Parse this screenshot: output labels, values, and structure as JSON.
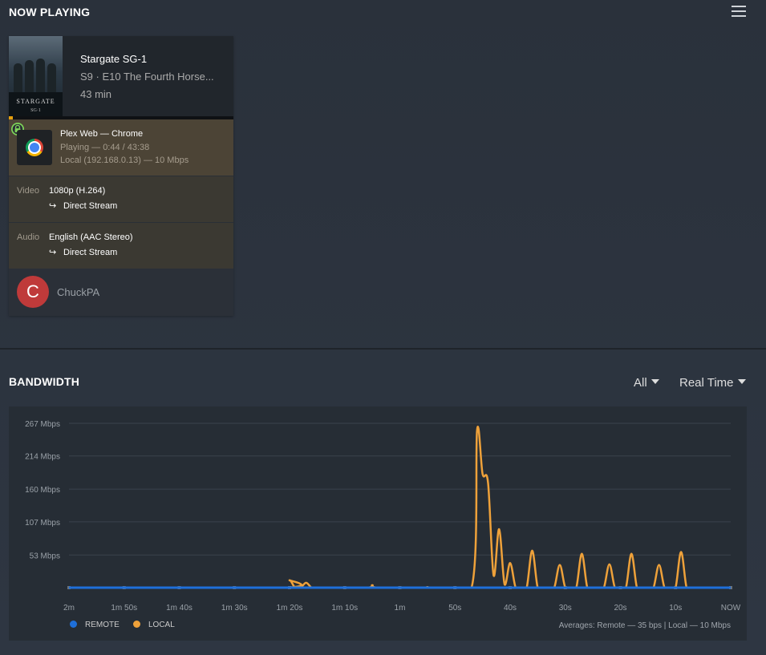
{
  "now_playing": {
    "title": "NOW PLAYING",
    "menu_icon": "list-menu-icon",
    "card": {
      "poster": {
        "title_text": "STARGATE",
        "sub_text": "SG·1"
      },
      "show": "Stargate SG-1",
      "episode": "S9 · E10 The Fourth Horse...",
      "duration": "43 min",
      "progress_fraction": 0.017,
      "player": {
        "lock_icon": "lock-icon",
        "browser_icon": "chrome-icon",
        "line1": "Plex Web  —  Chrome",
        "line2": "Playing — 0:44 / 43:38",
        "line3": "Local (192.168.0.13) — 10 Mbps"
      },
      "video": {
        "label": "Video",
        "value": "1080p (H.264)",
        "arrow": "↪",
        "stream": "Direct Stream"
      },
      "audio": {
        "label": "Audio",
        "value": "English (AAC Stereo)",
        "arrow": "↪",
        "stream": "Direct Stream"
      },
      "user": {
        "initial": "C",
        "name": "ChuckPA"
      }
    }
  },
  "bandwidth": {
    "title": "BANDWIDTH",
    "filter_all": "All",
    "filter_time": "Real Time",
    "legend": {
      "remote": "REMOTE",
      "local": "LOCAL"
    },
    "averages": "Averages: Remote — 35 bps | Local — 10 Mbps",
    "colors": {
      "remote": "#1e6fd9",
      "local": "#eea13a"
    }
  },
  "chart_data": {
    "type": "line",
    "ylabel": "",
    "xlabel": "",
    "y_ticks": [
      "53 Mbps",
      "107 Mbps",
      "160 Mbps",
      "214 Mbps",
      "267 Mbps"
    ],
    "y_tick_values": [
      53,
      107,
      160,
      214,
      267
    ],
    "ylim": [
      0,
      267
    ],
    "x_ticks": [
      "2m",
      "1m 50s",
      "1m 40s",
      "1m 30s",
      "1m 20s",
      "1m 10s",
      "1m",
      "50s",
      "40s",
      "30s",
      "20s",
      "10s",
      "NOW"
    ],
    "x_tick_values": [
      120,
      110,
      100,
      90,
      80,
      70,
      60,
      50,
      40,
      30,
      20,
      10,
      0
    ],
    "xlim": [
      120,
      0
    ],
    "grid": true,
    "legend_position": "bottom-left",
    "series": [
      {
        "name": "REMOTE",
        "x": [
          120,
          0
        ],
        "values": [
          0,
          0
        ]
      },
      {
        "name": "LOCAL",
        "x": [
          120,
          81,
          80,
          79,
          78,
          77,
          76,
          75,
          74,
          66,
          65,
          64,
          56,
          55,
          54,
          47,
          46,
          45,
          44,
          43,
          42,
          41,
          40,
          39,
          38,
          37,
          36,
          35,
          34,
          33,
          32,
          31,
          30,
          29,
          28,
          27,
          26,
          25,
          24,
          23,
          22,
          21,
          20,
          19,
          18,
          17,
          16,
          15,
          14,
          13,
          12,
          11,
          10,
          9,
          8,
          7,
          6,
          5,
          4,
          3,
          2,
          1,
          0
        ],
        "values": [
          0,
          0,
          12,
          0,
          0,
          8,
          0,
          0,
          0,
          0,
          4,
          0,
          0,
          1,
          0,
          0,
          255,
          185,
          170,
          20,
          95,
          5,
          40,
          0,
          0,
          0,
          60,
          0,
          0,
          0,
          0,
          37,
          0,
          0,
          0,
          55,
          0,
          0,
          0,
          0,
          38,
          0,
          0,
          0,
          55,
          0,
          0,
          0,
          0,
          37,
          0,
          0,
          0,
          58,
          0,
          0,
          0,
          0,
          0,
          0,
          0,
          0,
          0
        ]
      }
    ]
  }
}
